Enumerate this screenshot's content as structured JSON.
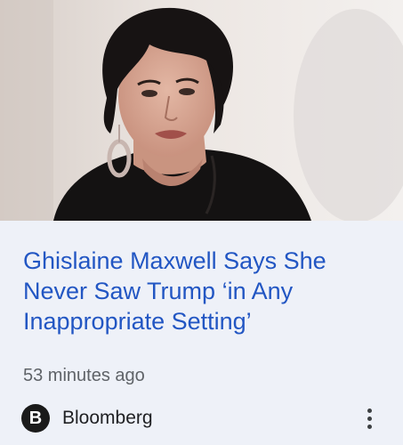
{
  "article": {
    "image_alt": "Ghislaine Maxwell portrait",
    "headline": "Ghislaine Maxwell Says She Never Saw Trump ‘in Any Inappropriate Setting’",
    "time_ago": "53 minutes ago",
    "source": {
      "logo_letter": "B",
      "name": "Bloomberg"
    }
  },
  "colors": {
    "headline": "#2256c3",
    "card_background": "#eef1f8",
    "meta_text": "#5f6368"
  },
  "icons": {
    "menu": "more-vert-icon",
    "source_logo": "bloomberg-logo-icon"
  }
}
